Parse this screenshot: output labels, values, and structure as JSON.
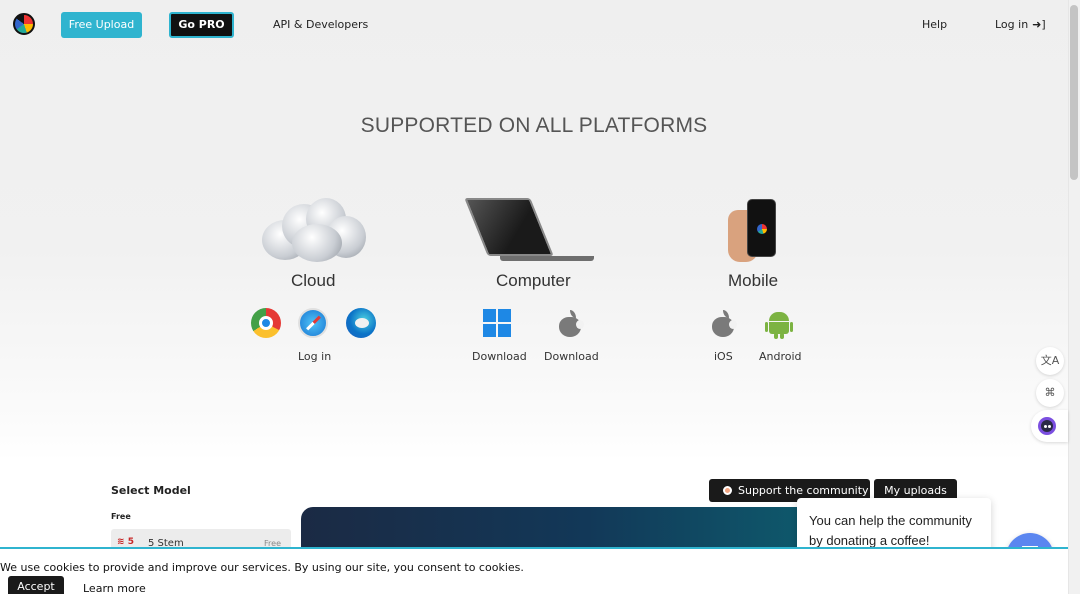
{
  "nav": {
    "free_upload": "Free Upload",
    "go_pro": "Go PRO",
    "api": "API & Developers",
    "help": "Help",
    "login": "Log in",
    "login_icon": "sign-in-icon"
  },
  "hero": {
    "headline": "SUPPORTED ON ALL PLATFORMS"
  },
  "platforms": {
    "cloud": {
      "title": "Cloud",
      "link": "Log in",
      "icons": [
        "chrome-icon",
        "safari-icon",
        "edge-icon"
      ]
    },
    "computer": {
      "title": "Computer",
      "windows_label": "Download",
      "mac_label": "Download",
      "icons": [
        "windows-icon",
        "apple-icon"
      ]
    },
    "mobile": {
      "title": "Mobile",
      "ios_label": "iOS",
      "android_label": "Android",
      "icons": [
        "apple-icon",
        "android-icon"
      ]
    }
  },
  "side_widgets": {
    "translate": "A̶",
    "grid": "⌘"
  },
  "model": {
    "heading": "Select Model",
    "tier": "Free",
    "row_flag": "5",
    "row_name": "5 Stem",
    "row_price": "Free"
  },
  "actions": {
    "support": "Support the community",
    "uploads": "My uploads"
  },
  "tooltip": {
    "text": "You can help the community by donating a coffee!"
  },
  "cookie": {
    "text": "We use cookies to provide and improve our services. By using our site, you consent to cookies.",
    "accept": "Accept",
    "learn_more": "Learn more"
  },
  "colors": {
    "accent": "#2fb4cf",
    "dark_button": "#1a1a1a",
    "coffee_button": "#5b86f0"
  }
}
